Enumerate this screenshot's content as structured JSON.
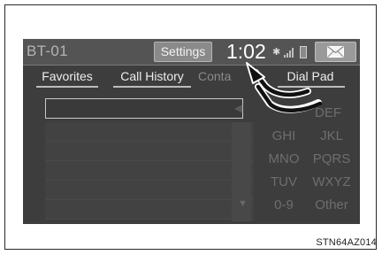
{
  "screen": {
    "device_name": "BT-01",
    "settings_label": "Settings",
    "clock": "1:02",
    "status_icons": [
      "bluetooth-icon",
      "signal-strength-icon",
      "battery-icon"
    ],
    "mail_icon": "envelope-icon"
  },
  "tabs": [
    {
      "label": "Favorites",
      "active": true
    },
    {
      "label": "Call History",
      "active": true
    },
    {
      "label": "Conta",
      "active": false
    },
    {
      "label": "Dial Pad",
      "active": true
    }
  ],
  "keypad": [
    "DEF",
    "GHI",
    "JKL",
    "MNO",
    "PQRS",
    "TUV",
    "WXYZ",
    "0-9",
    "Other"
  ],
  "figure_code": "STN64AZ014",
  "colors": {
    "screen_bg": "#3d3d3d",
    "statusbar_bg": "#545454",
    "callout_arrow": "#111111"
  }
}
